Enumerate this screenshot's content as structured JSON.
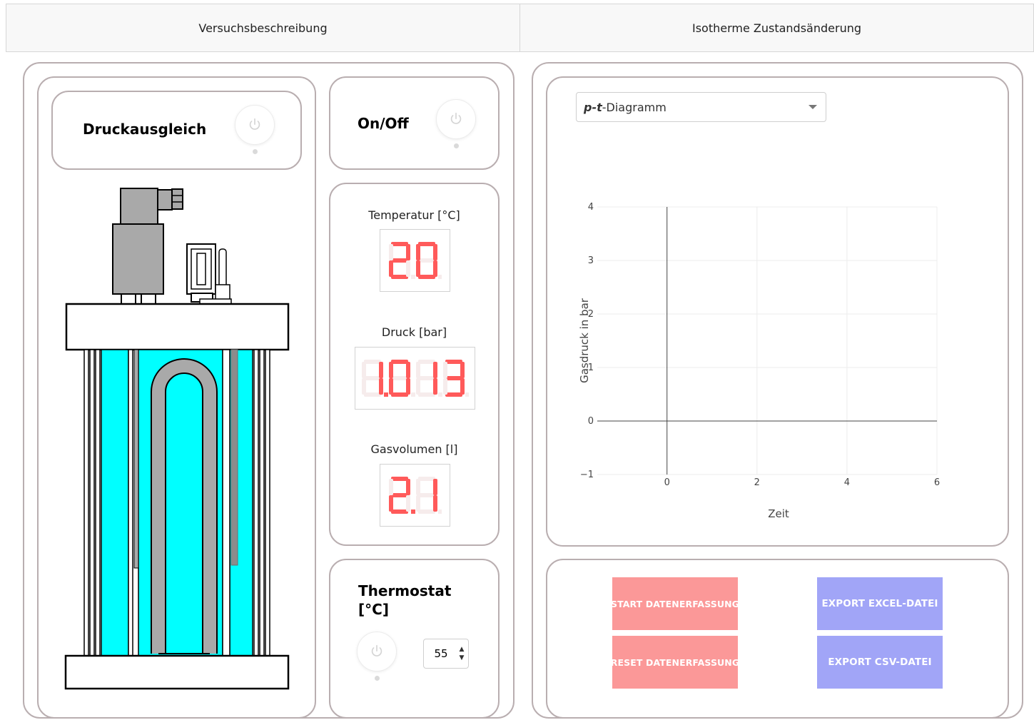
{
  "tabs": [
    {
      "label": "Versuchsbeschreibung"
    },
    {
      "label": "Isotherme Zustandsänderung"
    }
  ],
  "left": {
    "druckausgleich": {
      "label": "Druckausgleich"
    },
    "onoff": {
      "label": "On/Off"
    },
    "measurements": {
      "temperature": {
        "label": "Temperatur [°C]",
        "value": "20"
      },
      "pressure": {
        "label": "Druck [bar]",
        "value": "1.013"
      },
      "volume": {
        "label": "Gasvolumen [l]",
        "value": "2.1"
      }
    },
    "thermostat": {
      "label_line1": "Thermostat",
      "label_line2": "[°C]",
      "value": "55"
    }
  },
  "right": {
    "select": {
      "prefix": "p-t",
      "suffix": "-Diagramm"
    },
    "buttons": {
      "start": "START DATENERFASSUNG",
      "reset": "RESET DATENERFASSUNG",
      "excel": "EXPORT EXCEL-DATEI",
      "csv": "EXPORT CSV-DATEI"
    }
  },
  "colors": {
    "water": "#00ffff",
    "led_on": "#ff5a5a",
    "led_off": "#f6ecec",
    "button_red": "#fb9898",
    "button_blue": "#a1a5f7"
  },
  "icons": {
    "power": "power-icon",
    "caret": "chevron-down-icon"
  },
  "chart_data": {
    "type": "line",
    "series": [],
    "xlabel": "Zeit",
    "ylabel": "Gasdruck in bar",
    "xlim": [
      -1.55,
      6
    ],
    "ylim": [
      -1,
      4
    ],
    "xticks": [
      0,
      2,
      4,
      6
    ],
    "yticks": [
      -1,
      0,
      1,
      2,
      3,
      4
    ],
    "grid": true
  }
}
